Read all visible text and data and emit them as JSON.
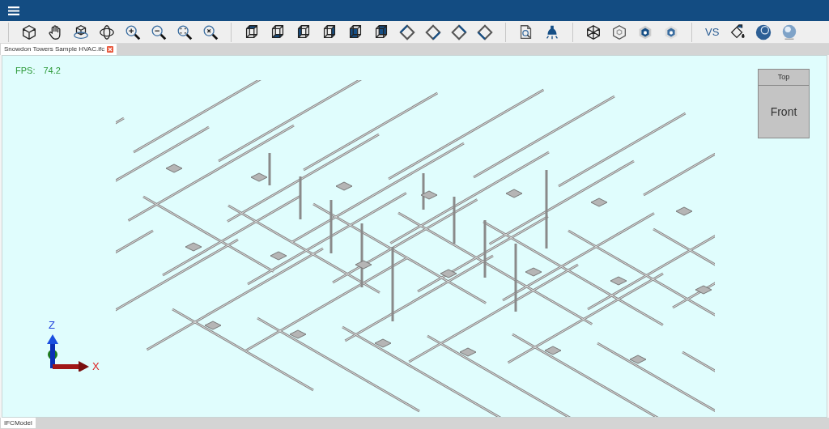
{
  "toolbar": {
    "vs_label": "VS"
  },
  "tabs": [
    {
      "label": "Snowdon Towers Sample HVAC.ifc",
      "selected": true
    }
  ],
  "viewport": {
    "fps_label": "FPS:",
    "fps_value": "74.2",
    "view_cube": {
      "top": "Top",
      "front": "Front"
    },
    "axes": {
      "z": "Z",
      "x": "X"
    }
  },
  "bottom_tabs": [
    {
      "label": "IFCModel",
      "selected": true
    }
  ]
}
